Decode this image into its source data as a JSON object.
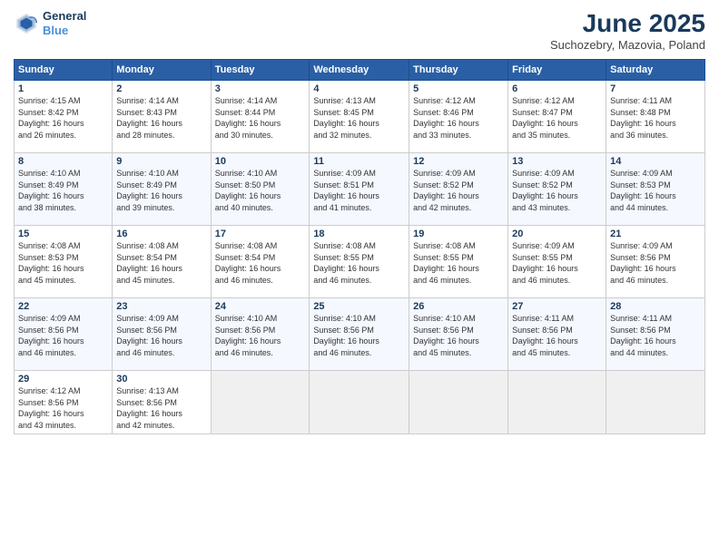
{
  "header": {
    "logo_line1": "General",
    "logo_line2": "Blue",
    "month": "June 2025",
    "location": "Suchozebry, Mazovia, Poland"
  },
  "weekdays": [
    "Sunday",
    "Monday",
    "Tuesday",
    "Wednesday",
    "Thursday",
    "Friday",
    "Saturday"
  ],
  "weeks": [
    [
      {
        "day": "1",
        "info": "Sunrise: 4:15 AM\nSunset: 8:42 PM\nDaylight: 16 hours\nand 26 minutes."
      },
      {
        "day": "2",
        "info": "Sunrise: 4:14 AM\nSunset: 8:43 PM\nDaylight: 16 hours\nand 28 minutes."
      },
      {
        "day": "3",
        "info": "Sunrise: 4:14 AM\nSunset: 8:44 PM\nDaylight: 16 hours\nand 30 minutes."
      },
      {
        "day": "4",
        "info": "Sunrise: 4:13 AM\nSunset: 8:45 PM\nDaylight: 16 hours\nand 32 minutes."
      },
      {
        "day": "5",
        "info": "Sunrise: 4:12 AM\nSunset: 8:46 PM\nDaylight: 16 hours\nand 33 minutes."
      },
      {
        "day": "6",
        "info": "Sunrise: 4:12 AM\nSunset: 8:47 PM\nDaylight: 16 hours\nand 35 minutes."
      },
      {
        "day": "7",
        "info": "Sunrise: 4:11 AM\nSunset: 8:48 PM\nDaylight: 16 hours\nand 36 minutes."
      }
    ],
    [
      {
        "day": "8",
        "info": "Sunrise: 4:10 AM\nSunset: 8:49 PM\nDaylight: 16 hours\nand 38 minutes."
      },
      {
        "day": "9",
        "info": "Sunrise: 4:10 AM\nSunset: 8:49 PM\nDaylight: 16 hours\nand 39 minutes."
      },
      {
        "day": "10",
        "info": "Sunrise: 4:10 AM\nSunset: 8:50 PM\nDaylight: 16 hours\nand 40 minutes."
      },
      {
        "day": "11",
        "info": "Sunrise: 4:09 AM\nSunset: 8:51 PM\nDaylight: 16 hours\nand 41 minutes."
      },
      {
        "day": "12",
        "info": "Sunrise: 4:09 AM\nSunset: 8:52 PM\nDaylight: 16 hours\nand 42 minutes."
      },
      {
        "day": "13",
        "info": "Sunrise: 4:09 AM\nSunset: 8:52 PM\nDaylight: 16 hours\nand 43 minutes."
      },
      {
        "day": "14",
        "info": "Sunrise: 4:09 AM\nSunset: 8:53 PM\nDaylight: 16 hours\nand 44 minutes."
      }
    ],
    [
      {
        "day": "15",
        "info": "Sunrise: 4:08 AM\nSunset: 8:53 PM\nDaylight: 16 hours\nand 45 minutes."
      },
      {
        "day": "16",
        "info": "Sunrise: 4:08 AM\nSunset: 8:54 PM\nDaylight: 16 hours\nand 45 minutes."
      },
      {
        "day": "17",
        "info": "Sunrise: 4:08 AM\nSunset: 8:54 PM\nDaylight: 16 hours\nand 46 minutes."
      },
      {
        "day": "18",
        "info": "Sunrise: 4:08 AM\nSunset: 8:55 PM\nDaylight: 16 hours\nand 46 minutes."
      },
      {
        "day": "19",
        "info": "Sunrise: 4:08 AM\nSunset: 8:55 PM\nDaylight: 16 hours\nand 46 minutes."
      },
      {
        "day": "20",
        "info": "Sunrise: 4:09 AM\nSunset: 8:55 PM\nDaylight: 16 hours\nand 46 minutes."
      },
      {
        "day": "21",
        "info": "Sunrise: 4:09 AM\nSunset: 8:56 PM\nDaylight: 16 hours\nand 46 minutes."
      }
    ],
    [
      {
        "day": "22",
        "info": "Sunrise: 4:09 AM\nSunset: 8:56 PM\nDaylight: 16 hours\nand 46 minutes."
      },
      {
        "day": "23",
        "info": "Sunrise: 4:09 AM\nSunset: 8:56 PM\nDaylight: 16 hours\nand 46 minutes."
      },
      {
        "day": "24",
        "info": "Sunrise: 4:10 AM\nSunset: 8:56 PM\nDaylight: 16 hours\nand 46 minutes."
      },
      {
        "day": "25",
        "info": "Sunrise: 4:10 AM\nSunset: 8:56 PM\nDaylight: 16 hours\nand 46 minutes."
      },
      {
        "day": "26",
        "info": "Sunrise: 4:10 AM\nSunset: 8:56 PM\nDaylight: 16 hours\nand 45 minutes."
      },
      {
        "day": "27",
        "info": "Sunrise: 4:11 AM\nSunset: 8:56 PM\nDaylight: 16 hours\nand 45 minutes."
      },
      {
        "day": "28",
        "info": "Sunrise: 4:11 AM\nSunset: 8:56 PM\nDaylight: 16 hours\nand 44 minutes."
      }
    ],
    [
      {
        "day": "29",
        "info": "Sunrise: 4:12 AM\nSunset: 8:56 PM\nDaylight: 16 hours\nand 43 minutes."
      },
      {
        "day": "30",
        "info": "Sunrise: 4:13 AM\nSunset: 8:56 PM\nDaylight: 16 hours\nand 42 minutes."
      },
      null,
      null,
      null,
      null,
      null
    ]
  ]
}
